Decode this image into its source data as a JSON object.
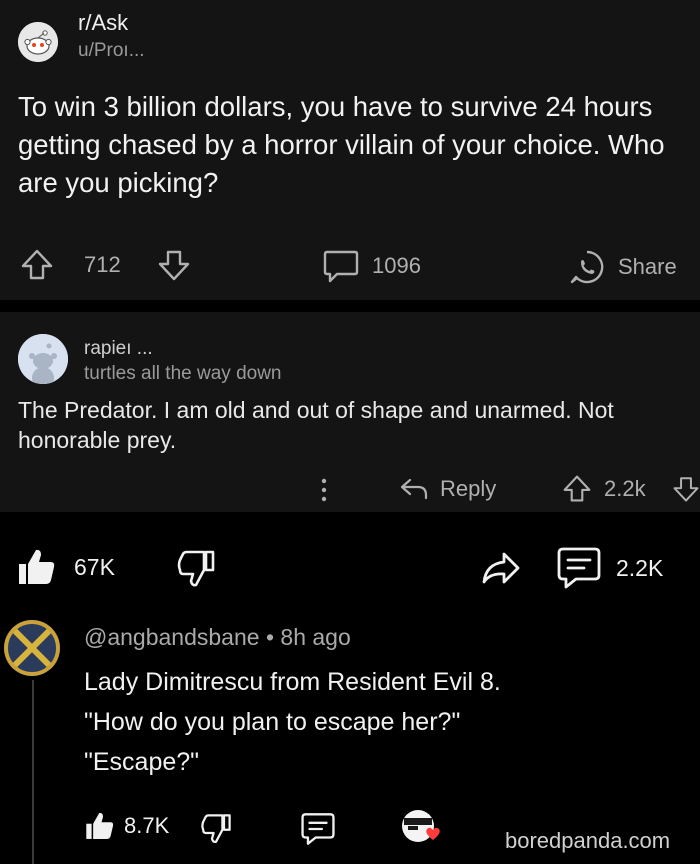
{
  "post": {
    "subreddit": "r/Ask",
    "username": "u/Proı...",
    "title": "To win 3 billion dollars, you have to survive 24 hours getting chased by a horror villain of your choice. Who are you picking?",
    "upvotes": "712",
    "comments": "1096",
    "share_label": "Share"
  },
  "comment": {
    "username": "rapieı ...",
    "flair": "turtles all the way down",
    "body": "The Predator.  I am old and out of shape and unarmed.  Not honorable prey.",
    "more_icon": "more-vertical-icon",
    "reply_label": "Reply",
    "score": "2.2k"
  },
  "yt_bar": {
    "likes": "67K",
    "replies": "2.2K"
  },
  "yt_comment": {
    "handle": "@angbandsbane",
    "separator": "•",
    "time": "8h ago",
    "lines": [
      "Lady Dimitrescu from Resident Evil 8.",
      "\"How do you plan to escape her?\"",
      "\"Escape?\""
    ],
    "likes": "8.7K"
  },
  "watermark": "boredpanda.com",
  "colors": {
    "card_bg": "#141414",
    "page_bg": "#000000",
    "muted_text": "#9a9a9a",
    "heart_red": "#ff3b3b"
  }
}
